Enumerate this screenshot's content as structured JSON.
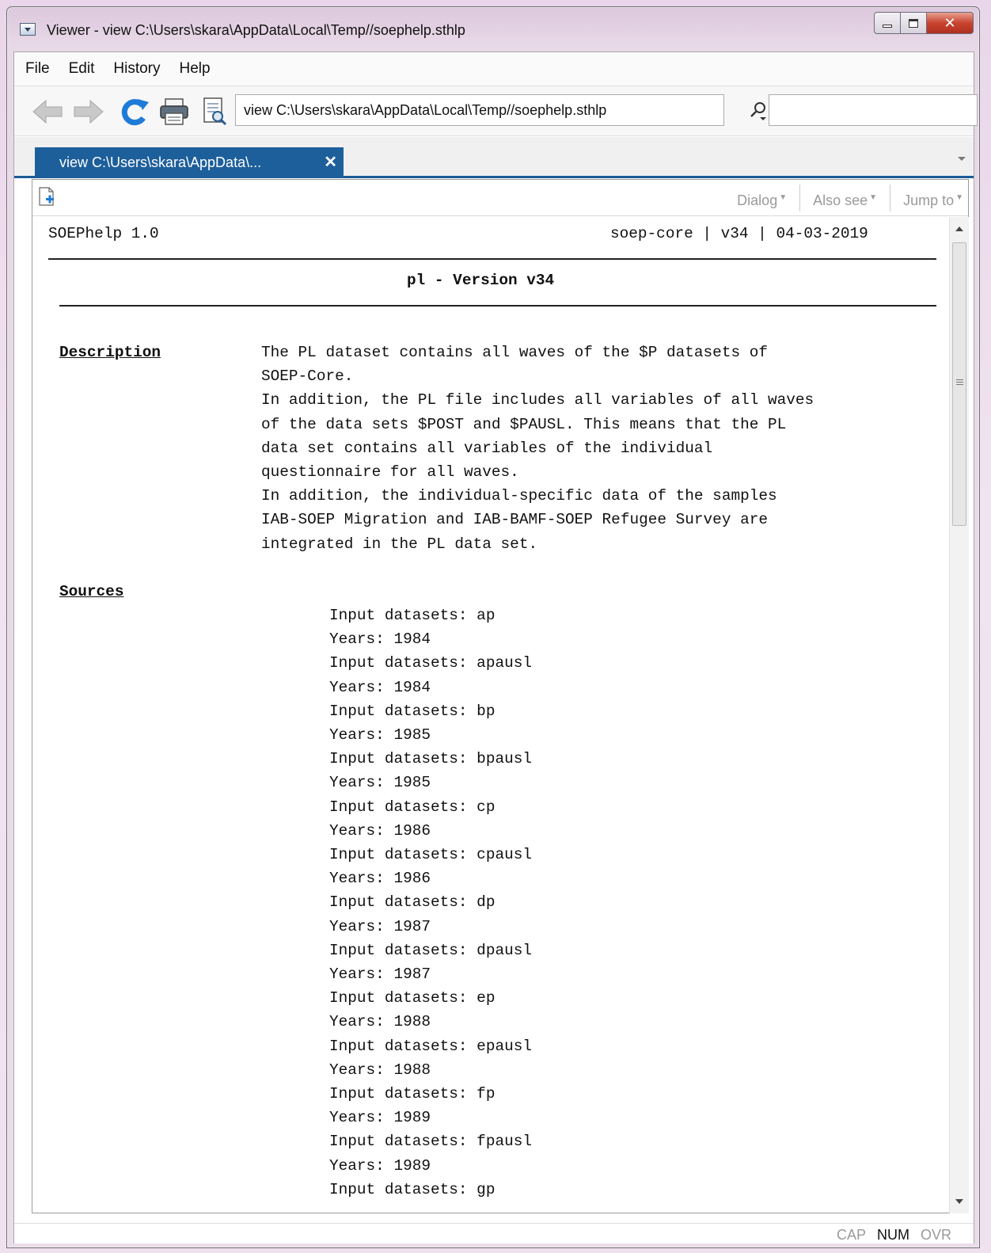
{
  "window": {
    "title": "Viewer - view C:\\Users\\skara\\AppData\\Local\\Temp//soephelp.sthlp"
  },
  "menu": [
    "File",
    "Edit",
    "History",
    "Help"
  ],
  "toolbar": {
    "url": "view C:\\Users\\skara\\AppData\\Local\\Temp//soephelp.sthlp",
    "search_value": ""
  },
  "tab": {
    "label": "view C:\\Users\\skara\\AppData\\...",
    "close": "✕"
  },
  "subbar": {
    "dialog": "Dialog",
    "also_see": "Also see",
    "jump_to": "Jump to"
  },
  "doc": {
    "header_left": "SOEPhelp 1.0",
    "header_right": "soep-core | v34 | 04-03-2019",
    "title": "pl - Version v34",
    "description_heading": "Description",
    "description_lines": [
      "The PL dataset contains all waves of the $P datasets of",
      "SOEP-Core.",
      "In addition, the PL file includes all variables of all waves",
      "of the data sets $POST and $PAUSL. This means that the PL",
      "data set contains all variables of the individual",
      "questionnaire for all waves.",
      "In addition, the individual-specific data of the samples",
      "IAB-SOEP Migration and IAB-BAMF-SOEP Refugee Survey are",
      "integrated in the PL data set."
    ],
    "sources_heading": "Sources",
    "sources_lines": [
      "Input datasets: ap",
      "Years: 1984",
      "Input datasets: apausl",
      "Years: 1984",
      "Input datasets: bp",
      "Years: 1985",
      "Input datasets: bpausl",
      "Years: 1985",
      "Input datasets: cp",
      "Years: 1986",
      "Input datasets: cpausl",
      "Years: 1986",
      "Input datasets: dp",
      "Years: 1987",
      "Input datasets: dpausl",
      "Years: 1987",
      "Input datasets: ep",
      "Years: 1988",
      "Input datasets: epausl",
      "Years: 1988",
      "Input datasets: fp",
      "Years: 1989",
      "Input datasets: fpausl",
      "Years: 1989",
      "Input datasets: gp"
    ]
  },
  "status": {
    "cap": "CAP",
    "num": "NUM",
    "ovr": "OVR"
  },
  "colors": {
    "tab_active": "#1d5f9b",
    "close_button": "#c8442f",
    "refresh_icon": "#1e7bd8",
    "disabled_text": "#9a9a9a"
  }
}
